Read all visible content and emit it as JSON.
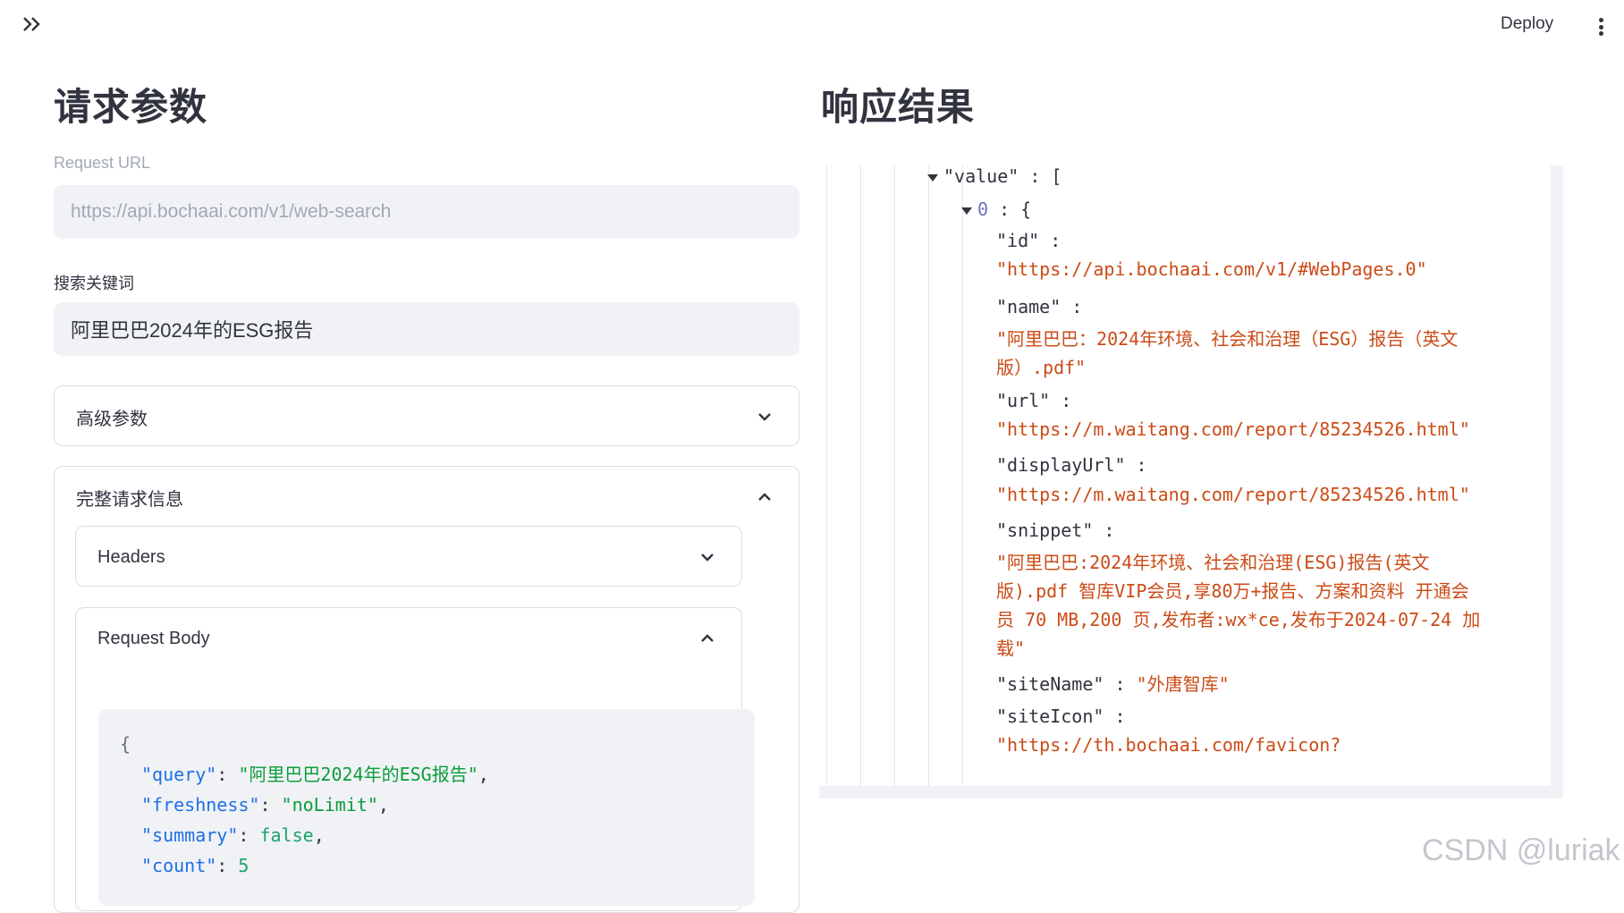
{
  "header": {
    "deploy_label": "Deploy"
  },
  "left": {
    "title": "请求参数",
    "request_url": {
      "label": "Request URL",
      "value": "https://api.bochaai.com/v1/web-search"
    },
    "keyword": {
      "label": "搜索关键词",
      "value": "阿里巴巴2024年的ESG报告"
    },
    "advanced": {
      "label": "高级参数"
    },
    "full_request": {
      "label": "完整请求信息",
      "headers_label": "Headers",
      "body_label": "Request Body",
      "body": {
        "open_brace": "{",
        "fields": [
          {
            "key": "\"query\"",
            "value": "\"阿里巴巴2024年的ESG报告\"",
            "sep": ",",
            "kind": "str"
          },
          {
            "key": "\"freshness\"",
            "value": "\"noLimit\"",
            "sep": ",",
            "kind": "str"
          },
          {
            "key": "\"summary\"",
            "value": "false",
            "sep": ",",
            "kind": "kw"
          },
          {
            "key": "\"count\"",
            "value": "5",
            "sep": "",
            "kind": "num"
          }
        ]
      }
    }
  },
  "right": {
    "title": "响应结果",
    "json": {
      "value_key": "\"value\"",
      "index0": "0",
      "id_key": "\"id\"",
      "id_val": "\"https://api.bochaai.com/v1/#WebPages.0\"",
      "name_key": "\"name\"",
      "name_val_1": "\"阿里巴巴：2024年环境、社会和治理（ESG）报告（英文",
      "name_val_2": "版）.pdf\"",
      "url_key": "\"url\"",
      "url_val": "\"https://m.waitang.com/report/85234526.html\"",
      "displayurl_key": "\"displayUrl\"",
      "displayurl_val": "\"https://m.waitang.com/report/85234526.html\"",
      "snippet_key": "\"snippet\"",
      "snippet_1": "\"阿里巴巴:2024年环境、社会和治理(ESG)报告(英文",
      "snippet_2": "版).pdf 智库VIP会员,享80万+报告、方案和资料 开通会",
      "snippet_3": "员 70 MB,200 页,发布者:wx*ce,发布于2024-07-24 加",
      "snippet_4": "载\"",
      "sitename_key": "\"siteName\"",
      "sitename_val": "\"外唐智库\"",
      "siteicon_key": "\"siteIcon\"",
      "siteicon_val": "\"https://th.bochaai.com/favicon?"
    }
  },
  "watermark": "CSDN @luriak"
}
